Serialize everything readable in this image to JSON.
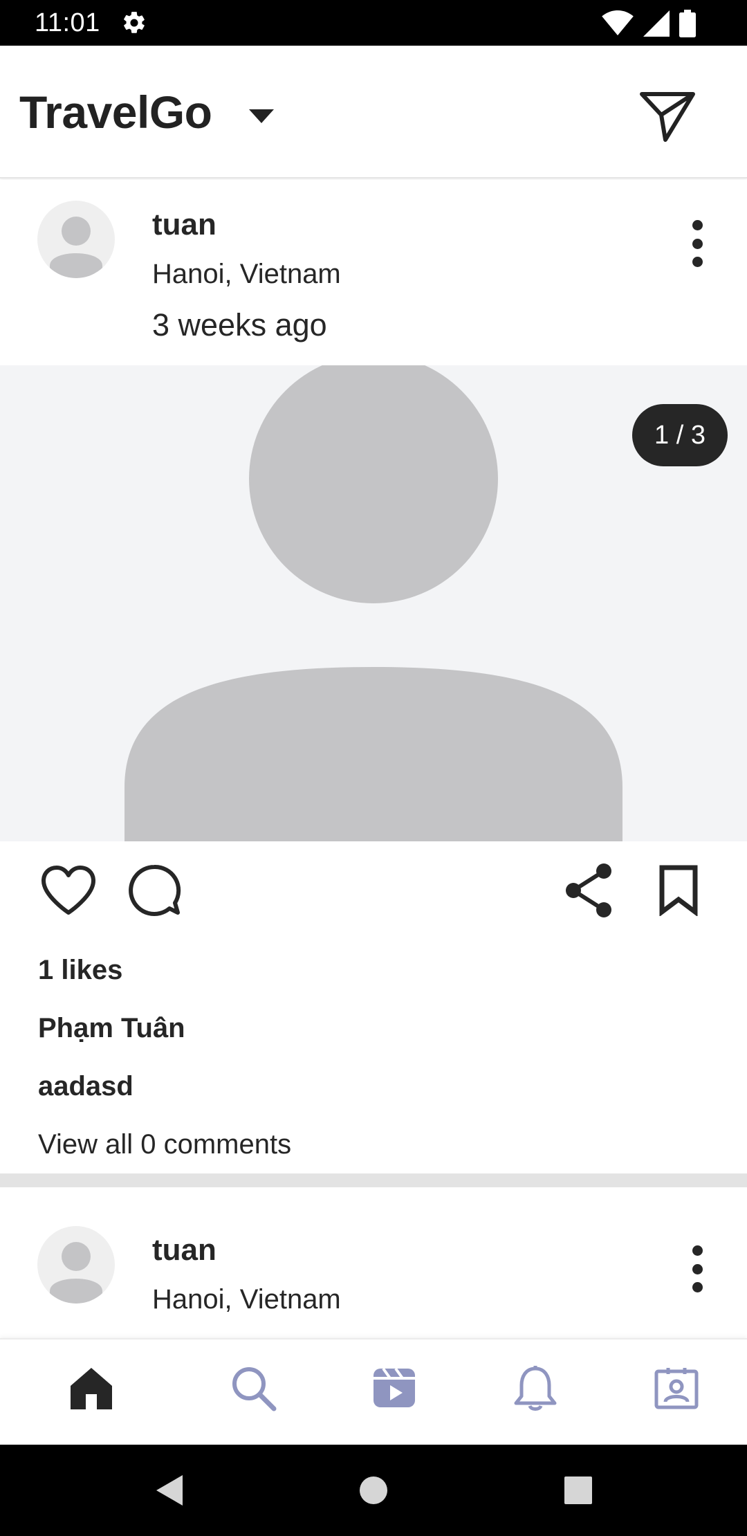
{
  "status_bar": {
    "time": "11:01",
    "icons": [
      "gear-icon",
      "wifi-icon",
      "signal-icon",
      "battery-icon"
    ]
  },
  "app_bar": {
    "title": "TravelGo",
    "icons": [
      "chevron-down-icon",
      "send-icon"
    ]
  },
  "posts": [
    {
      "username": "tuan",
      "location": "Hanoi, Vietnam",
      "time_ago": "3 weeks ago",
      "media_counter": "1 / 3",
      "likes": "1 likes",
      "author": "Phạm Tuân",
      "caption": "aadasd",
      "comments_link": "View all 0 comments"
    },
    {
      "username": "tuan",
      "location": "Hanoi, Vietnam"
    }
  ],
  "bottom_nav": {
    "items": [
      "home-icon",
      "search-icon",
      "reels-icon",
      "bell-icon",
      "profile-icon"
    ],
    "active_color": "#262626",
    "inactive_color": "#8f95c0"
  },
  "system_nav": [
    "back-icon",
    "home-circle-icon",
    "recents-icon"
  ]
}
